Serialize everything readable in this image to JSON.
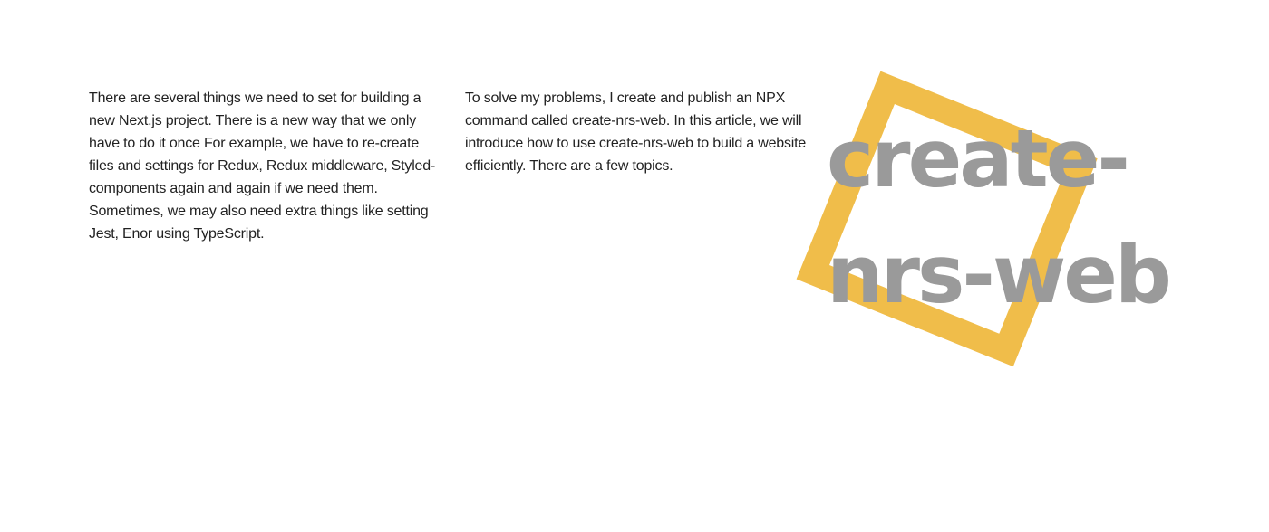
{
  "article": {
    "intro_paragraph": "There are several things we need to set for building a new Next.js project. There is a new way that we only have to do it once For example, we have to re-create files and settings for Redux, Redux middleware, Styled-components again and again if we need them. Sometimes, we may also need extra things like setting Jest, Enor using TypeScript.",
    "solution_paragraph": "To solve my problems, I create and publish an NPX command called create-nrs-web. In this article, we will introduce how to use create-nrs-web to build a website efficiently. There are a few topics."
  },
  "hero": {
    "title_line_1": "create-",
    "title_line_2": "nrs-web"
  },
  "colors": {
    "text": "#222222",
    "hero_text": "#9a9a9a",
    "accent_frame": "#f0bd4a",
    "background": "#ffffff"
  }
}
